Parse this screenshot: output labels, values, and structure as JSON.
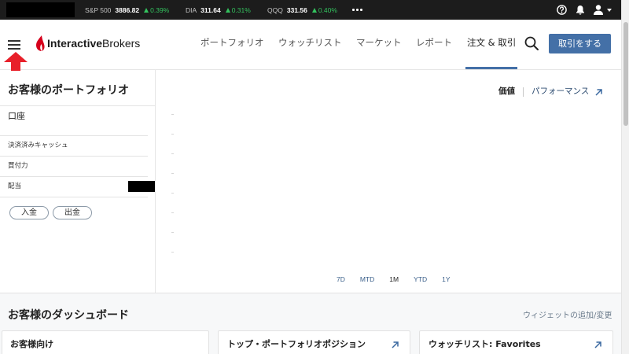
{
  "topbar": {
    "tickers": [
      {
        "symbol": "S&P 500",
        "value": "3886.82",
        "change": "0.39%",
        "change_icon": "up-triangle-icon"
      },
      {
        "symbol": "DIA",
        "value": "311.64",
        "change": "0.31%",
        "change_icon": "up-triangle-icon"
      },
      {
        "symbol": "QQQ",
        "value": "331.56",
        "change": "0.40%",
        "change_icon": "up-triangle-icon"
      }
    ],
    "icons": [
      "more-icon",
      "help-icon",
      "bell-icon",
      "user-icon",
      "chevron-down-icon"
    ]
  },
  "header": {
    "logo": {
      "bold": "Interactive",
      "regular": "Brokers"
    },
    "nav": [
      {
        "label": "ポートフォリオ",
        "active": false
      },
      {
        "label": "ウォッチリスト",
        "active": false
      },
      {
        "label": "マーケット",
        "active": false
      },
      {
        "label": "レポート",
        "active": false
      },
      {
        "label": "注文 & 取引",
        "active": true
      }
    ],
    "trade_button": "取引をする",
    "icons": [
      "hamburger-menu-icon",
      "search-icon"
    ]
  },
  "portfolio": {
    "title": "お客様のポートフォリオ",
    "account_label": "口座",
    "rows": [
      {
        "label": "決済済みキャッシュ"
      },
      {
        "label": "買付力"
      },
      {
        "label": "配当"
      }
    ],
    "deposit_button": "入金",
    "withdraw_button": "出金"
  },
  "chart_panel": {
    "value_tab": "価値",
    "performance_link": "パフォーマンス",
    "ranges": [
      {
        "label": "7D",
        "selected": false
      },
      {
        "label": "MTD",
        "selected": false
      },
      {
        "label": "1M",
        "selected": true
      },
      {
        "label": "YTD",
        "selected": false
      },
      {
        "label": "1Y",
        "selected": false
      }
    ]
  },
  "dashboard": {
    "title": "お客様のダッシュボード",
    "edit_link": "ウィジェットの追加/変更",
    "cards": [
      {
        "title": "お客様向け",
        "has_link_icon": false
      },
      {
        "title": "トップ・ポートフォリオポジション",
        "has_link_icon": true
      },
      {
        "title": "ウォッチリスト: Favorites",
        "has_link_icon": true
      }
    ]
  },
  "colors": {
    "topbar_bg": "#1c1c1c",
    "positive": "#33c25e",
    "brand_red": "#d6001c",
    "primary_blue": "#4470a7",
    "link_blue": "#2b4a6f",
    "annotation_red": "#e8202a"
  }
}
